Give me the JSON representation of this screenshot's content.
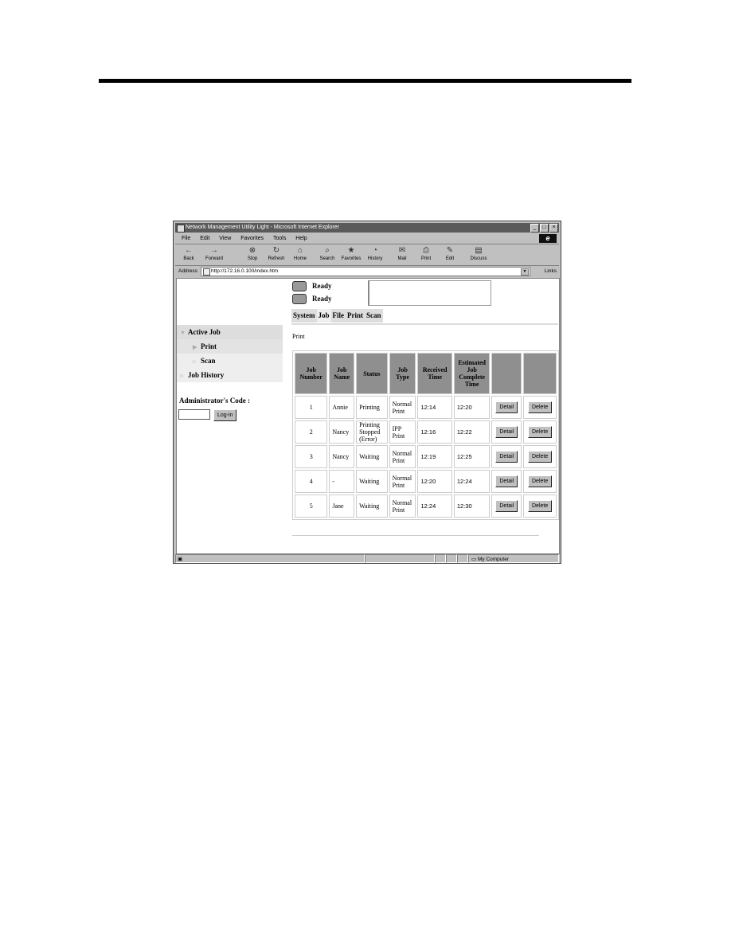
{
  "window": {
    "title": "Network Management Utility Light - Microsoft Internet Explorer",
    "controls": [
      "_",
      "□",
      "×"
    ]
  },
  "menu": [
    "File",
    "Edit",
    "View",
    "Favorites",
    "Tools",
    "Help"
  ],
  "toolbar": [
    {
      "label": "Back",
      "icon": "←"
    },
    {
      "label": "Forward",
      "icon": "→"
    },
    {
      "label": "Stop",
      "icon": "⊗"
    },
    {
      "label": "Refresh",
      "icon": "↻"
    },
    {
      "label": "Home",
      "icon": "⌂"
    },
    {
      "label": "Search",
      "icon": "⌕"
    },
    {
      "label": "Favorites",
      "icon": "★"
    },
    {
      "label": "History",
      "icon": "◔"
    },
    {
      "label": "Mail",
      "icon": "✉"
    },
    {
      "label": "Print",
      "icon": "⎙"
    },
    {
      "label": "Edit",
      "icon": "✎"
    },
    {
      "label": "Discuss",
      "icon": "▤"
    }
  ],
  "address": {
    "label": "Address",
    "url": "http://172.16.0.100/index.htm",
    "links": "Links"
  },
  "printer_status": [
    "Ready",
    "Ready"
  ],
  "tabs": [
    "System",
    "Job",
    "File",
    "Print",
    "Scan"
  ],
  "nav": {
    "active_job": "Active Job",
    "print": "Print",
    "scan": "Scan",
    "job_history": "Job History"
  },
  "admin": {
    "label": "Administrator's Code :",
    "login_button": "Log-in"
  },
  "section_title": "Print",
  "table": {
    "headers": [
      "Job Number",
      "Job Name",
      "Status",
      "Job Type",
      "Received Time",
      "Estimated Job Complete Time",
      "",
      ""
    ],
    "rows": [
      {
        "number": "1",
        "name": "Annie",
        "status": "Printing",
        "type": "Normal Print",
        "received": "12:14",
        "complete": "12:20"
      },
      {
        "number": "2",
        "name": "Nancy",
        "status": "Printing Stopped (Error)",
        "type": "IPP Print",
        "received": "12:16",
        "complete": "12:22"
      },
      {
        "number": "3",
        "name": "Nancy",
        "status": "Waiting",
        "type": "Normal Print",
        "received": "12:19",
        "complete": "12:25"
      },
      {
        "number": "4",
        "name": "-",
        "status": "Waiting",
        "type": "Normal Print",
        "received": "12:20",
        "complete": "12:24"
      },
      {
        "number": "5",
        "name": "Jane",
        "status": "Waiting",
        "type": "Normal Print",
        "received": "12:24",
        "complete": "12:30"
      }
    ],
    "detail_label": "Detail",
    "delete_label": "Delete"
  },
  "statusbar": {
    "zone": "My Computer"
  }
}
